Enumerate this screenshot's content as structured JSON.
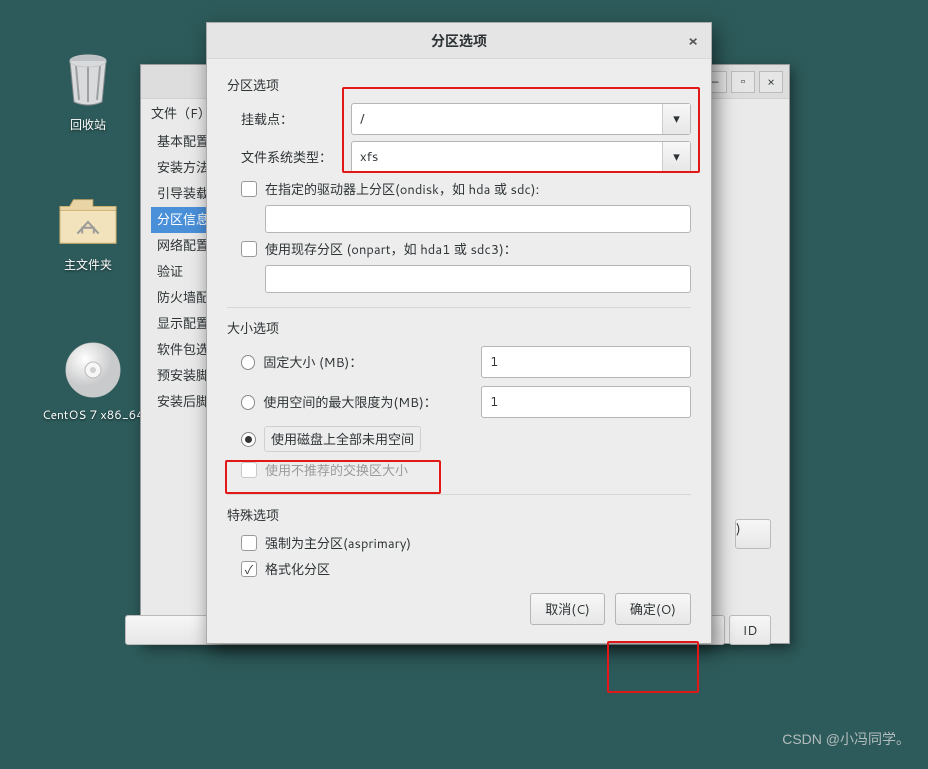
{
  "desktop": {
    "icons": [
      {
        "name": "trash",
        "label": "回收站"
      },
      {
        "name": "home",
        "label": "主文件夹"
      },
      {
        "name": "disc",
        "label": "CentOS 7 x86_64"
      }
    ]
  },
  "parent_window": {
    "menu_file": "文件（F）",
    "sidebar": [
      {
        "label": "基本配置"
      },
      {
        "label": "安装方法"
      },
      {
        "label": "引导装载"
      },
      {
        "label": "分区信息",
        "active": true
      },
      {
        "label": "网络配置"
      },
      {
        "label": "验证"
      },
      {
        "label": "防火墙配"
      },
      {
        "label": "显示配置"
      },
      {
        "label": "软件包选"
      },
      {
        "label": "预安装脚"
      },
      {
        "label": "安装后脚"
      }
    ]
  },
  "dialog": {
    "title": "分区选项",
    "close_glyph": "×",
    "sections": {
      "partition_options": "分区选项",
      "size_options": "大小选项",
      "special_options": "特殊选项"
    },
    "fields": {
      "mount_label": "挂载点：",
      "mount_value": "/",
      "fstype_label": "文件系统类型：",
      "fstype_value": "xfs",
      "ondisk_label": "在指定的驱动器上分区(ondisk，如 hda 或 sdc):",
      "ondisk_value": "",
      "onpart_label": "使用现存分区 (onpart，如 hda1 或 sdc3)：",
      "onpart_value": ""
    },
    "size": {
      "fixed_label": "固定大小 (MB)：",
      "fixed_value": "1",
      "grow_label": "使用空间的最大限度为(MB)：",
      "grow_value": "1",
      "fill_label": "使用磁盘上全部未用空间",
      "recommended_label": "使用不推荐的交换区大小",
      "selected": "fill"
    },
    "special": {
      "asprimary_label": "强制为主分区(asprimary)",
      "asprimary_checked": false,
      "format_label": "格式化分区",
      "format_checked": true
    },
    "buttons": {
      "cancel": "取消(C)",
      "ok": "确定(O)"
    }
  },
  "peek_button_label": "ID",
  "watermark": "CSDN @小冯同学。"
}
